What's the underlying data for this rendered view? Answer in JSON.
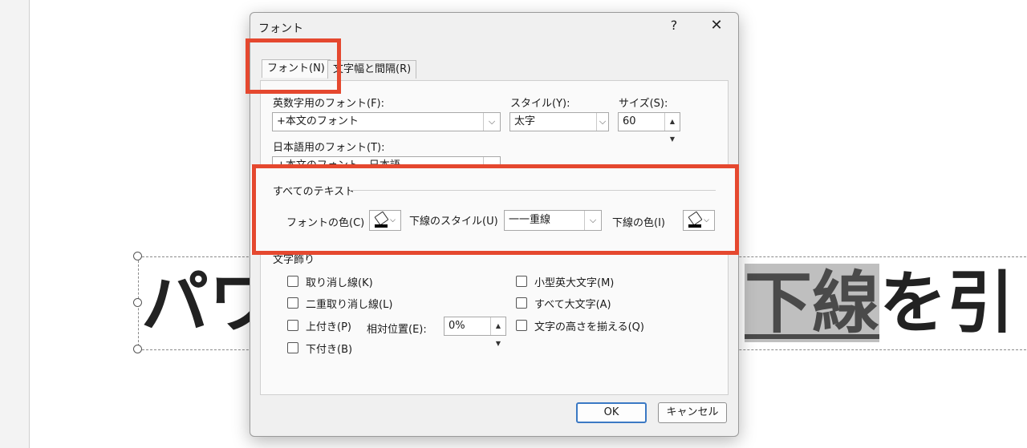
{
  "slide": {
    "text_before": "パワ",
    "text_highlight": "下線",
    "text_after": "を引"
  },
  "dialog": {
    "title": "フォント",
    "help": "?",
    "close": "✕",
    "tabs": [
      "フォント(N)",
      "文字幅と間隔(R)"
    ],
    "latin_font": {
      "label": "英数字用のフォント(F):",
      "value": "+本文のフォント"
    },
    "style": {
      "label": "スタイル(Y):",
      "value": "太字"
    },
    "size": {
      "label": "サイズ(S):",
      "value": "60"
    },
    "asian_font": {
      "label": "日本語用のフォント(T):",
      "value": "+本文のフォント - 日本語"
    },
    "all_text": {
      "group_label": "すべてのテキスト",
      "font_color_label": "フォントの色(C)",
      "underline_style_label": "下線のスタイル(U)",
      "underline_style_value": "一一重線",
      "underline_color_label": "下線の色(I)",
      "font_color": "#000000",
      "underline_color": "#000000"
    },
    "effects": {
      "group_label": "文字飾り",
      "strikethrough": "取り消し線(K)",
      "double_strikethrough": "二重取り消し線(L)",
      "superscript": "上付き(P)",
      "offset_label": "相対位置(E):",
      "offset_value": "0%",
      "subscript": "下付き(B)",
      "small_caps": "小型英大文字(M)",
      "all_caps": "すべて大文字(A)",
      "equalize_height": "文字の高さを揃える(Q)"
    },
    "ok": "OK",
    "cancel": "キャンセル"
  },
  "colors": {
    "highlight_red": "#e5482f",
    "ok_border": "#3b79c4"
  }
}
